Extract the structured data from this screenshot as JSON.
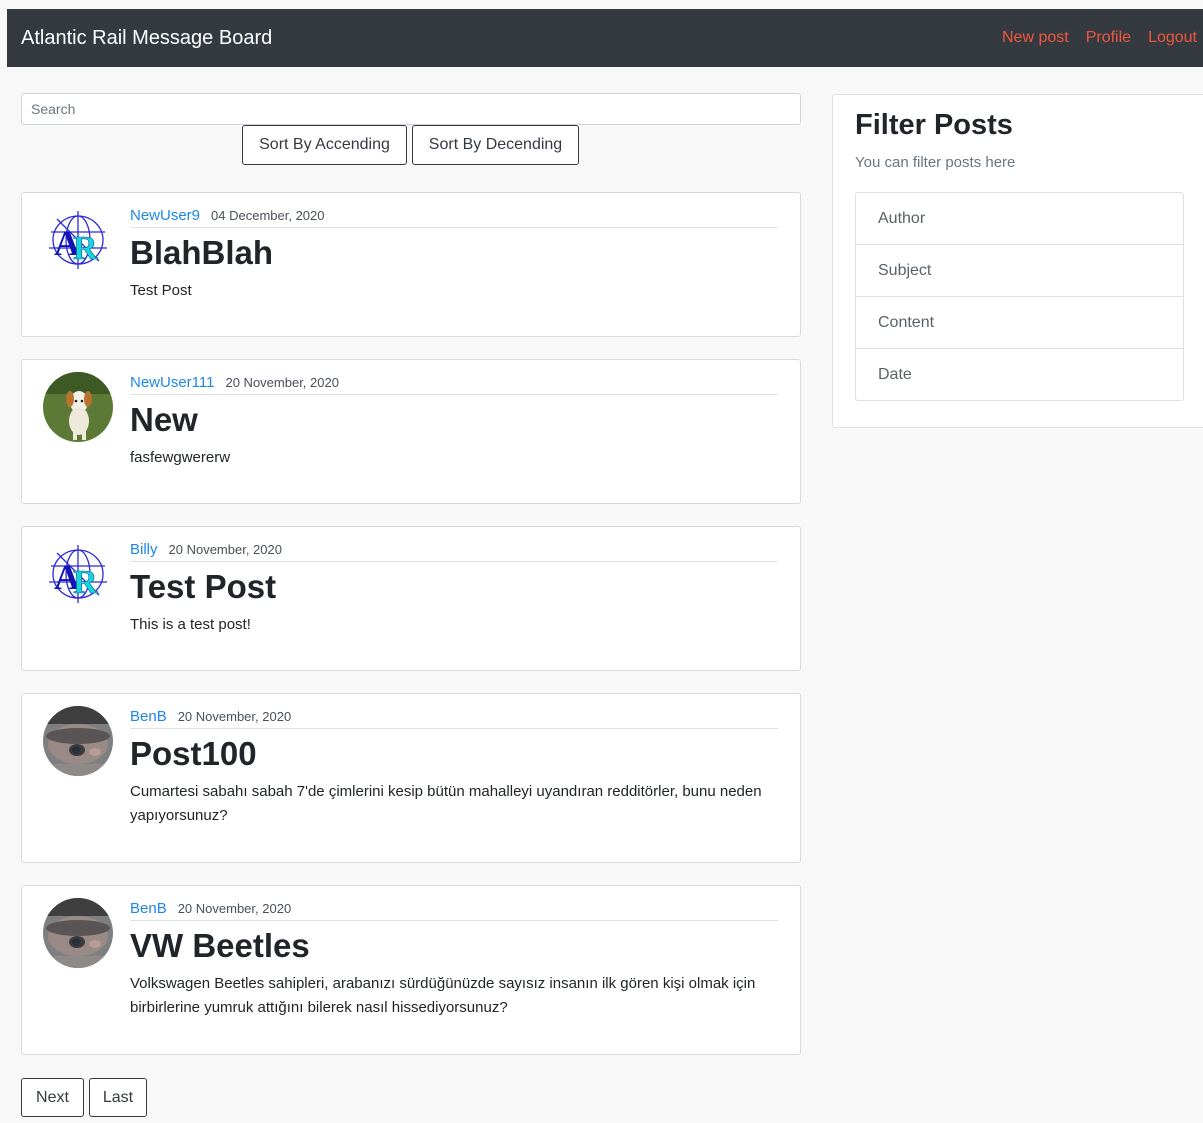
{
  "header": {
    "brand": "Atlantic Rail Message Board",
    "links": [
      "New post",
      "Profile",
      "Logout"
    ],
    "link_color": "#f0573d"
  },
  "search": {
    "placeholder": "Search"
  },
  "sort": {
    "ascending_label": "Sort By Accending",
    "descending_label": "Sort By Decending"
  },
  "posts": [
    {
      "author": "NewUser9",
      "date": "04 December, 2020",
      "title": "BlahBlah",
      "content": "Test Post",
      "avatar": "ar-logo-icon"
    },
    {
      "author": "NewUser111",
      "date": "20 November, 2020",
      "title": "New",
      "content": "fasfewgwererw",
      "avatar": "dog-photo-icon"
    },
    {
      "author": "Billy",
      "date": "20 November, 2020",
      "title": "Test Post",
      "content": "This is a test post!",
      "avatar": "ar-logo-icon"
    },
    {
      "author": "BenB",
      "date": "20 November, 2020",
      "title": "Post100",
      "content": "Cumartesi sabahı sabah 7'de çimlerini kesip bütün mahalleyi uyandıran redditörler, bunu neden yapıyorsunuz?",
      "avatar": "face-photo-icon"
    },
    {
      "author": "BenB",
      "date": "20 November, 2020",
      "title": "VW Beetles",
      "content": "Volkswagen Beetles sahipleri, arabanızı sürdüğünüzde sayısız insanın ilk gören kişi olmak için birbirlerine yumruk attığını bilerek nasıl hissediyorsunuz?",
      "avatar": "face-photo-icon"
    }
  ],
  "pagination": {
    "next_label": "Next",
    "last_label": "Last"
  },
  "filter": {
    "title": "Filter Posts",
    "subtitle": "You can filter posts here",
    "options": [
      "Author",
      "Subject",
      "Content",
      "Date"
    ]
  }
}
